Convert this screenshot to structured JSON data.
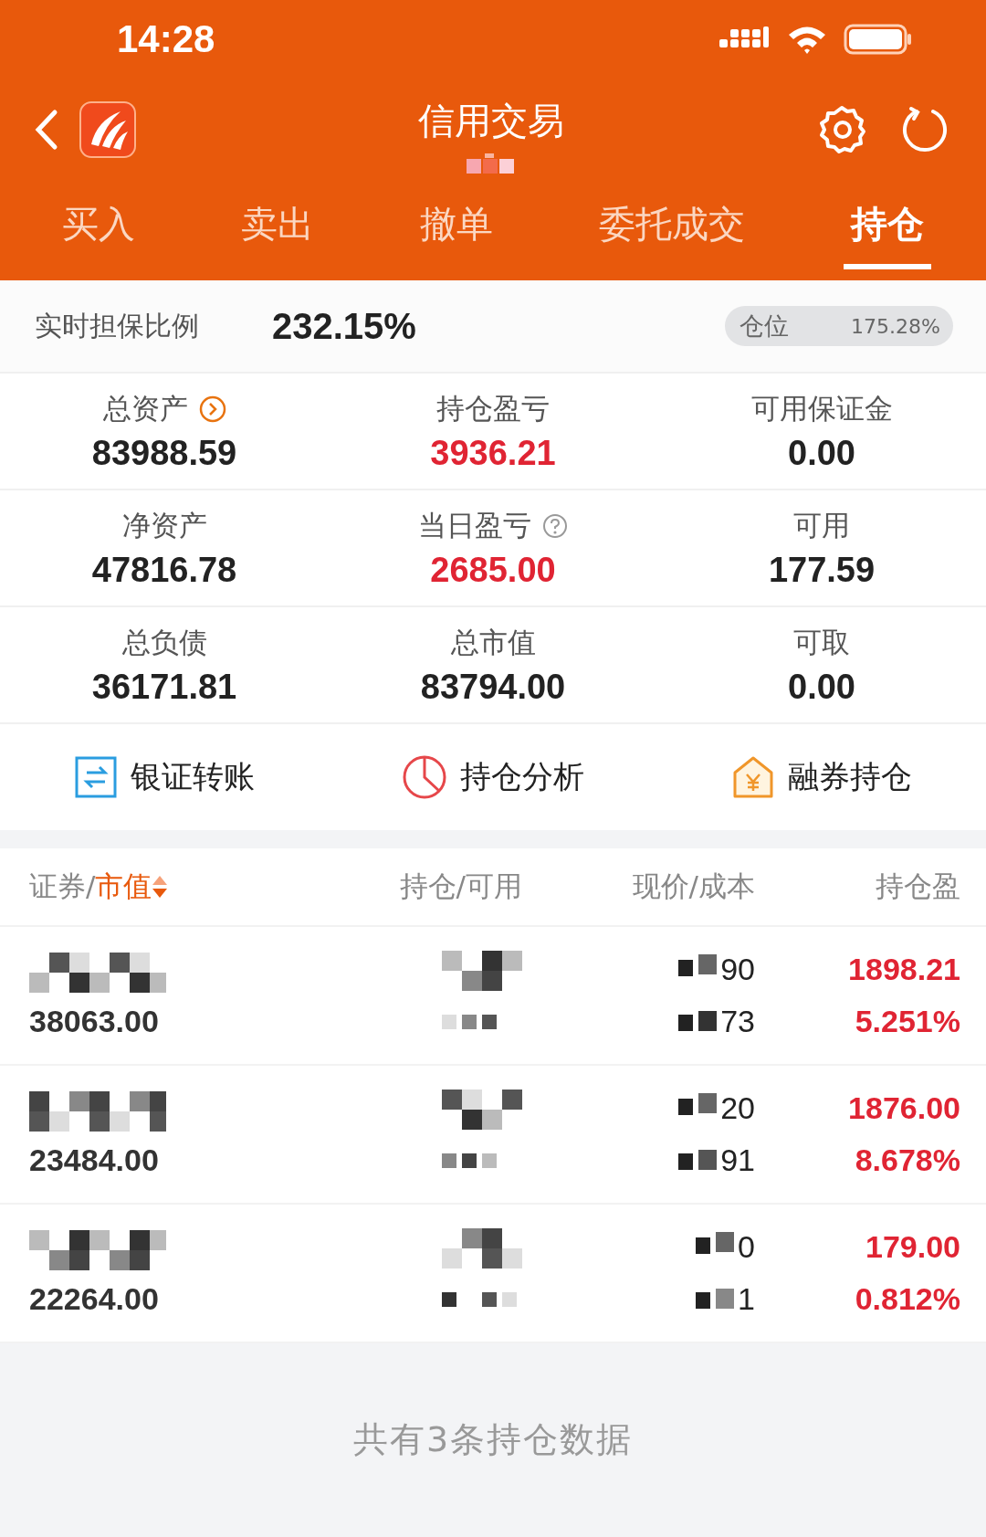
{
  "status_bar": {
    "time": "14:28"
  },
  "nav": {
    "title": "信用交易"
  },
  "tabs": [
    {
      "label": "买入",
      "selected": false
    },
    {
      "label": "卖出",
      "selected": false
    },
    {
      "label": "撤单",
      "selected": false
    },
    {
      "label": "委托成交",
      "selected": false
    },
    {
      "label": "持仓",
      "selected": true
    }
  ],
  "ratio": {
    "label": "实时担保比例",
    "value": "232.15%",
    "position": {
      "label": "仓位",
      "value": "175.28%"
    }
  },
  "stats": [
    {
      "label": "总资产",
      "value": "83988.59",
      "kind": "link",
      "highlight": false
    },
    {
      "label": "持仓盈亏",
      "value": "3936.21",
      "kind": "plain",
      "highlight": true
    },
    {
      "label": "可用保证金",
      "value": "0.00",
      "kind": "plain",
      "highlight": false
    },
    {
      "label": "净资产",
      "value": "47816.78",
      "kind": "plain",
      "highlight": false
    },
    {
      "label": "当日盈亏",
      "value": "2685.00",
      "kind": "help",
      "highlight": true
    },
    {
      "label": "可用",
      "value": "177.59",
      "kind": "plain",
      "highlight": false
    },
    {
      "label": "总负债",
      "value": "36171.81",
      "kind": "plain",
      "highlight": false
    },
    {
      "label": "总市值",
      "value": "83794.00",
      "kind": "plain",
      "highlight": false
    },
    {
      "label": "可取",
      "value": "0.00",
      "kind": "plain",
      "highlight": false
    }
  ],
  "actions": [
    {
      "label": "银证转账",
      "kind": "transfer"
    },
    {
      "label": "持仓分析",
      "kind": "analysis"
    },
    {
      "label": "融券持仓",
      "kind": "lending"
    }
  ],
  "table": {
    "columns": [
      {
        "label": "证券/",
        "sort_label": "市值"
      },
      {
        "label": "持仓/可用"
      },
      {
        "label": "现价/成本"
      },
      {
        "label": "持仓盈"
      }
    ],
    "rows": [
      {
        "market_value": "38063.00",
        "price": "90",
        "cost": "73",
        "profit": "1898.21",
        "profit_pct": "5.251%"
      },
      {
        "market_value": "23484.00",
        "price": "20",
        "cost": "91",
        "profit": "1876.00",
        "profit_pct": "8.678%"
      },
      {
        "market_value": "22264.00",
        "price": "0",
        "cost": "1",
        "profit": "179.00",
        "profit_pct": "0.812%"
      }
    ]
  },
  "footer": "共有3条持仓数据"
}
